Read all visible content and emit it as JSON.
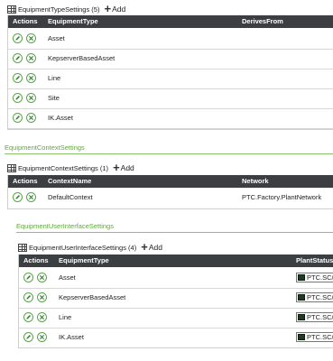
{
  "equipment_type_settings": {
    "title": "EquipmentTypeSettings (5)",
    "add_label": "Add",
    "columns": [
      "Actions",
      "EquipmentType",
      "DerivesFrom"
    ],
    "rows": [
      "Asset",
      "KepserverBasedAsset",
      "Line",
      "Site",
      "IK.Asset"
    ]
  },
  "equipment_context_section": {
    "heading": "EquipmentContextSettings",
    "title": "EquipmentContextSettings (1)",
    "add_label": "Add",
    "columns": [
      "Actions",
      "ContextName",
      "Network"
    ],
    "rows": [
      {
        "name": "DefaultContext",
        "network": "PTC.Factory.PlantNetwork"
      }
    ]
  },
  "equipment_ui_section": {
    "heading": "EquipmentUserInterfaceSettings",
    "title": "EquipmentUserInterfaceSettings (4)",
    "add_label": "Add",
    "columns": [
      "Actions",
      "EquipmentType",
      "PlantStatusF"
    ],
    "rows": [
      {
        "type": "Asset",
        "status": "PTC.SC/"
      },
      {
        "type": "KepserverBasedAsset",
        "status": "PTC.SC/"
      },
      {
        "type": "Line",
        "status": "PTC.SC/"
      },
      {
        "type": "IK.Asset",
        "status": "PTC.SC/"
      }
    ]
  },
  "colors": {
    "header_bg": "#3b3f42",
    "accent_green": "#5fa83a",
    "action_icon_green": "#5aa54a"
  },
  "icons": [
    "table-grid-icon",
    "plus-icon",
    "edit-pencil-icon",
    "delete-x-icon",
    "status-swatch-icon"
  ]
}
